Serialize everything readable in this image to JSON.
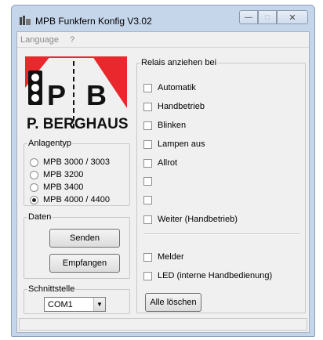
{
  "window": {
    "title": "MPB Funkfern Konfig V3.02",
    "minimize_glyph": "—",
    "maximize_glyph": "□",
    "close_glyph": "✕"
  },
  "menu": {
    "items": [
      {
        "label": "Language"
      },
      {
        "label": "?"
      }
    ]
  },
  "logo": {
    "text": "P. BERGHAUS",
    "letters": "P  B"
  },
  "anlagentyp": {
    "legend": "Anlagentyp",
    "options": [
      {
        "label": "MPB 3000 / 3003",
        "checked": false
      },
      {
        "label": "MPB 3200",
        "checked": false
      },
      {
        "label": "MPB 3400",
        "checked": false
      },
      {
        "label": "MPB 4000 / 4400",
        "checked": true
      }
    ]
  },
  "daten": {
    "legend": "Daten",
    "send_label": "Senden",
    "receive_label": "Empfangen"
  },
  "schnittstelle": {
    "legend": "Schnittstelle",
    "selected": "COM1"
  },
  "relais": {
    "legend": "Relais anziehen bei",
    "items": [
      {
        "label": "Automatik",
        "checked": false
      },
      {
        "label": "Handbetrieb",
        "checked": false
      },
      {
        "label": "Blinken",
        "checked": false
      },
      {
        "label": "Lampen aus",
        "checked": false
      },
      {
        "label": "Allrot",
        "checked": false
      },
      {
        "label": "",
        "checked": false
      },
      {
        "label": "",
        "checked": false
      },
      {
        "label": "Weiter (Handbetrieb)",
        "checked": false
      }
    ],
    "extra_items": [
      {
        "label": "Melder",
        "checked": false
      },
      {
        "label": "LED (interne Handbedienung)",
        "checked": false
      }
    ],
    "clear_label": "Alle löschen"
  },
  "colors": {
    "logo_red": "#e8282d",
    "frame_blue": "#c6d6ea"
  }
}
